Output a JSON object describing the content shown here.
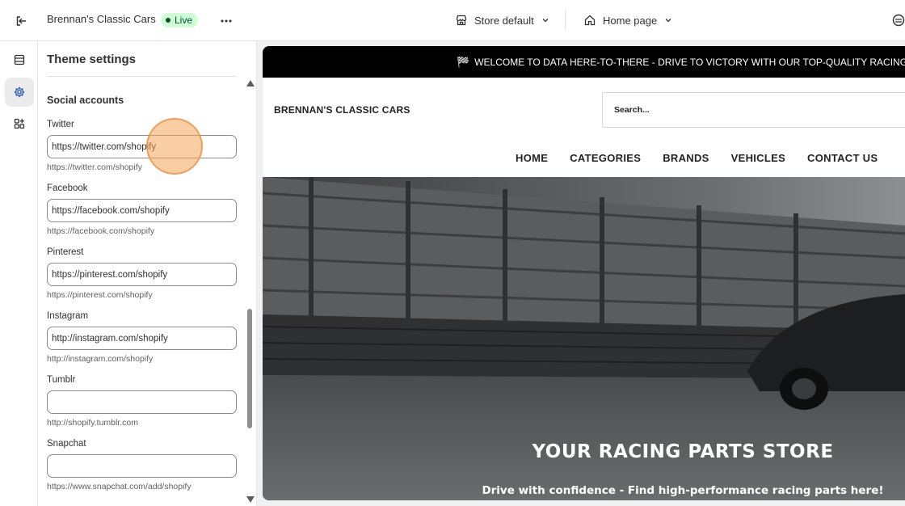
{
  "topbar": {
    "store_name": "Brennan's Classic Cars",
    "status_badge": "Live",
    "theme_selector": "Store default",
    "page_selector": "Home page"
  },
  "panel": {
    "title": "Theme settings",
    "section_title": "Social accounts",
    "fields": [
      {
        "label": "Twitter",
        "value": "https://twitter.com/shopify",
        "help": "https://twitter.com/shopify"
      },
      {
        "label": "Facebook",
        "value": "https://facebook.com/shopify",
        "help": "https://facebook.com/shopify"
      },
      {
        "label": "Pinterest",
        "value": "https://pinterest.com/shopify",
        "help": "https://pinterest.com/shopify"
      },
      {
        "label": "Instagram",
        "value": "http://instagram.com/shopify",
        "help": "http://instagram.com/shopify"
      },
      {
        "label": "Tumblr",
        "value": "",
        "help": "http://shopify.tumblr.com"
      },
      {
        "label": "Snapchat",
        "value": "",
        "help": "https://www.snapchat.com/add/shopify"
      }
    ]
  },
  "preview": {
    "announcement": "WELCOME TO DATA HERE-TO-THERE - DRIVE TO VICTORY WITH OUR TOP-QUALITY RACING PARTS!",
    "brand": "BRENNAN'S CLASSIC CARS",
    "search_placeholder": "Search...",
    "nav": [
      "HOME",
      "CATEGORIES",
      "BRANDS",
      "VEHICLES",
      "CONTACT US"
    ],
    "hero_title": "YOUR RACING PARTS STORE",
    "hero_subtitle": "Drive with confidence - Find high-performance racing parts here!"
  },
  "colors": {
    "live_badge_bg": "#cdfed4",
    "active_rail_bg": "#ebebeb",
    "announcement_bg": "#000000"
  },
  "icons": {
    "exit": "exit-icon",
    "more": "more-icon",
    "store": "store-icon",
    "home": "home-icon",
    "sections": "sections-icon",
    "settings": "gear-icon",
    "apps": "apps-icon"
  }
}
